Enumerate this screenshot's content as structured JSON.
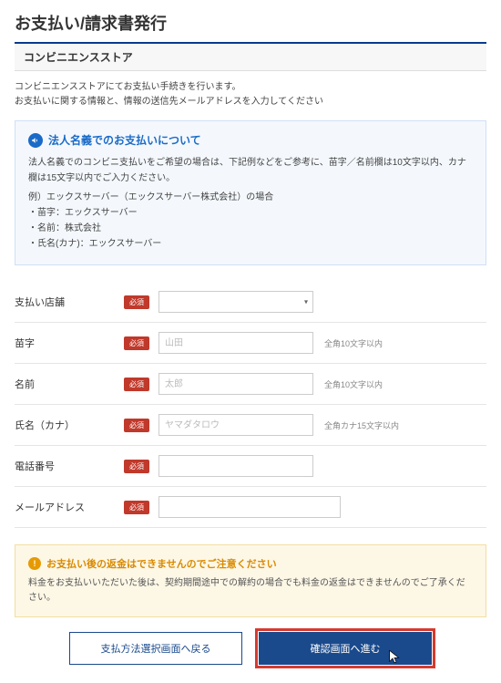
{
  "page_title": "お支払い/請求書発行",
  "section_title": "コンビニエンスストア",
  "intro_line1": "コンビニエンスストアにてお支払い手続きを行います。",
  "intro_line2": "お支払いに関する情報と、情報の送信先メールアドレスを入力してください",
  "info": {
    "title": "法人名義でのお支払いについて",
    "line1": "法人名義でのコンビニ支払いをご希望の場合は、下記例などをご参考に、苗字／名前欄は10文字以内、カナ欄は15文字以内でご入力ください。",
    "example_label": "例）エックスサーバー（エックスサーバー株式会社）の場合",
    "ex1": "・苗字：エックスサーバー",
    "ex2": "・名前：株式会社",
    "ex3": "・氏名(カナ)：エックスサーバー"
  },
  "required_label": "必須",
  "fields": {
    "store": {
      "label": "支払い店舗",
      "placeholder": "　"
    },
    "lastname": {
      "label": "苗字",
      "placeholder": "山田",
      "hint": "全角10文字以内"
    },
    "firstname": {
      "label": "名前",
      "placeholder": "太郎",
      "hint": "全角10文字以内"
    },
    "kana": {
      "label": "氏名（カナ）",
      "placeholder": "ヤマダタロウ",
      "hint": "全角カナ15文字以内"
    },
    "phone": {
      "label": "電話番号",
      "placeholder": ""
    },
    "email": {
      "label": "メールアドレス",
      "placeholder": ""
    }
  },
  "warning": {
    "title": "お支払い後の返金はできませんのでご注意ください",
    "body": "料金をお支払いいただいた後は、契約期間途中での解約の場合でも料金の返金はできませんのでご了承ください。"
  },
  "buttons": {
    "back": "支払方法選択画面へ戻る",
    "confirm": "確認画面へ進む"
  }
}
